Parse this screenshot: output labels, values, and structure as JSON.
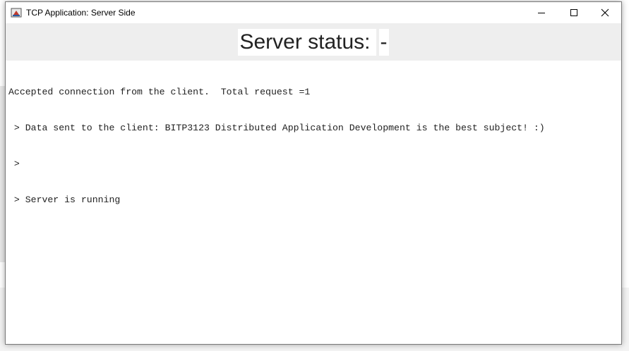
{
  "window": {
    "title": "TCP Application: Server Side",
    "buttons": {
      "minimize": "minimize",
      "maximize": "maximize",
      "close": "close"
    }
  },
  "status": {
    "label": "Server status:",
    "value": "-"
  },
  "log": {
    "lines": [
      "Accepted connection from the client.  Total request =1",
      " > Data sent to the client: BITP3123 Distributed Application Development is the best subject! :)",
      " >",
      " > Server is running"
    ]
  },
  "colors": {
    "accent_code": "#7a1f5c",
    "panel_bg": "#eeeeee"
  }
}
